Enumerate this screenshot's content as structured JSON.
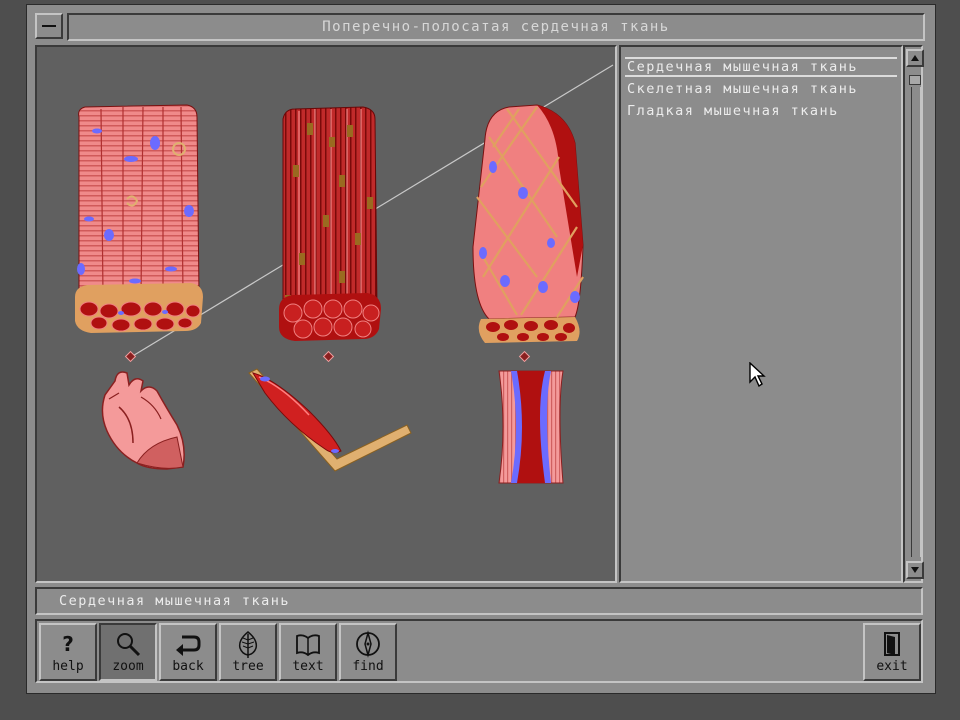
{
  "window": {
    "title": "Поперечно-полосатая сердечная ткань"
  },
  "tissue_list": {
    "items": [
      {
        "label": "Сердечная мышечная ткань",
        "selected": true
      },
      {
        "label": "Скелетная мышечная ткань",
        "selected": false
      },
      {
        "label": "Гладкая мышечная ткань",
        "selected": false
      }
    ]
  },
  "status": {
    "text": "Сердечная мышечная ткань"
  },
  "toolbar": {
    "help": "help",
    "zoom": "zoom",
    "back": "back",
    "tree": "tree",
    "text": "text",
    "find": "find",
    "exit": "exit"
  },
  "colors": {
    "window_gray": "#8c8c8c",
    "view_bg": "#606060",
    "tissue_pink": "#f08080",
    "tissue_red": "#b01010",
    "nucleus_blue": "#6b6bff",
    "tendon_tan": "#e0b070"
  }
}
